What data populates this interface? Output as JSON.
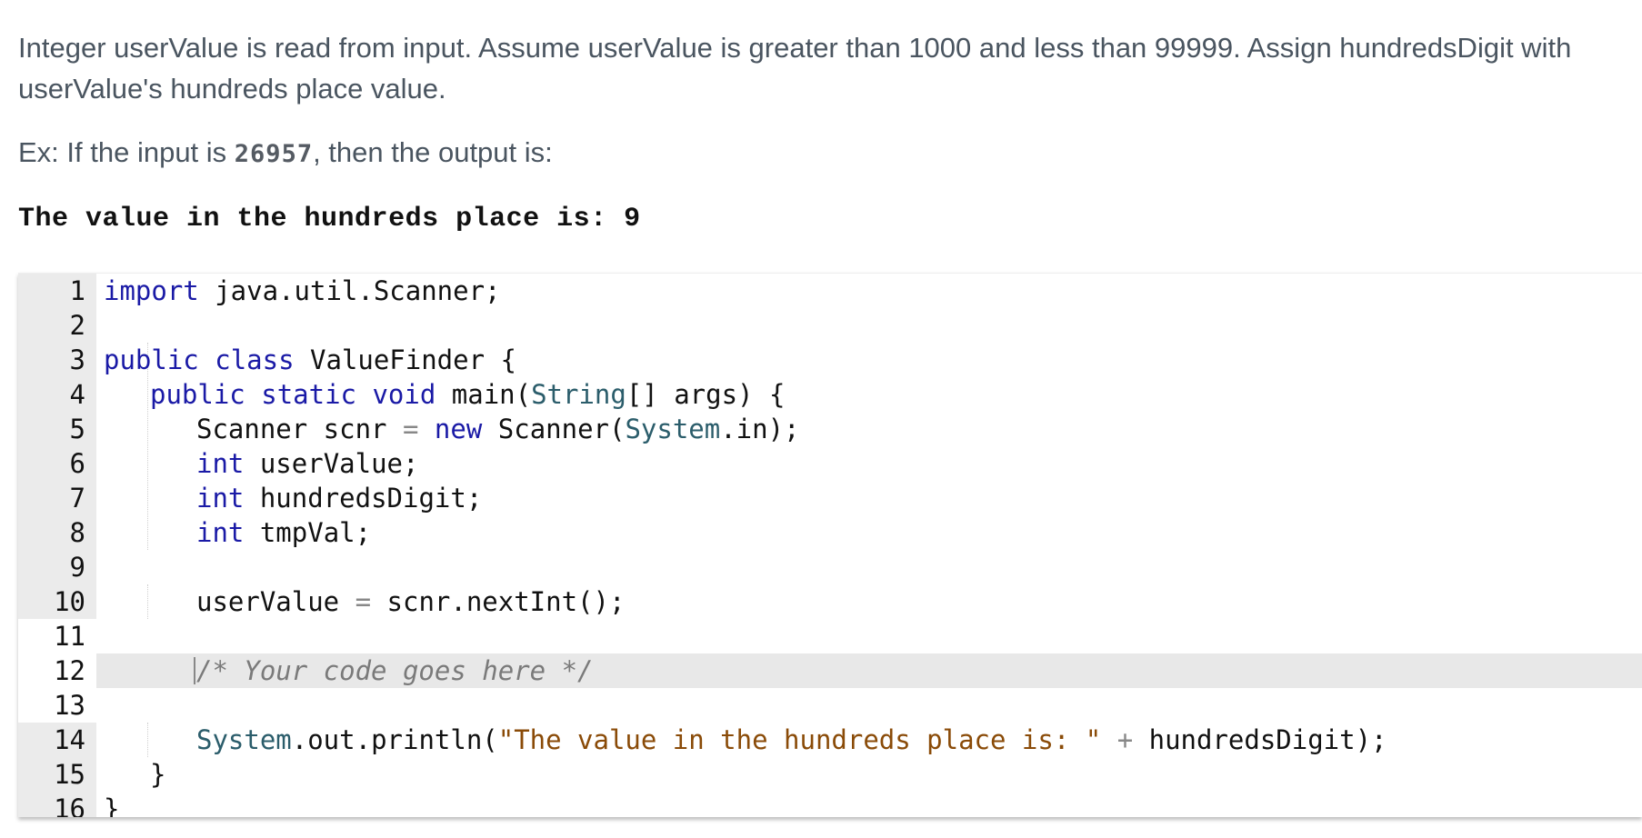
{
  "prompt": {
    "line1": "Integer userValue is read from input. Assume userValue is greater than 1000 and less than 99999. Assign hundredsDigit with",
    "line2": "userValue's hundreds place value.",
    "example_prefix": "Ex: If the input is ",
    "example_input": "26957",
    "example_suffix": ", then the output is:",
    "sample_output": "The value in the hundreds place is: 9"
  },
  "editor": {
    "line_numbers": [
      "1",
      "2",
      "3",
      "4",
      "5",
      "6",
      "7",
      "8",
      "9",
      "10",
      "11",
      "12",
      "13",
      "14",
      "15",
      "16"
    ],
    "lines": {
      "l1_kw": "import",
      "l1_rest": " java.util.Scanner;",
      "l3_kw1": "public",
      "l3_kw2": "class",
      "l3_rest": " ValueFinder {",
      "l4_kw1": "public",
      "l4_kw2": "static",
      "l4_kw3": "void",
      "l4_a": " main(",
      "l4_type": "String",
      "l4_b": "[] args) {",
      "l5_a": "Scanner scnr ",
      "l5_eq": "=",
      "l5_kw": "new",
      "l5_b": " Scanner(",
      "l5_type": "System",
      "l5_c": ".in);",
      "l6_kw": "int",
      "l6_rest": " userValue;",
      "l7_kw": "int",
      "l7_rest": " hundredsDigit;",
      "l8_kw": "int",
      "l8_rest": " tmpVal;",
      "l10_a": "userValue ",
      "l10_eq": "=",
      "l10_b": " scnr.nextInt();",
      "l12_comment": "/* Your code goes here */",
      "l14_type": "System",
      "l14_a": ".out.println(",
      "l14_str": "\"The value in the hundreds place is: \"",
      "l14_plus": "+",
      "l14_b": " hundredsDigit);",
      "l15": "}",
      "l16": "}"
    }
  }
}
